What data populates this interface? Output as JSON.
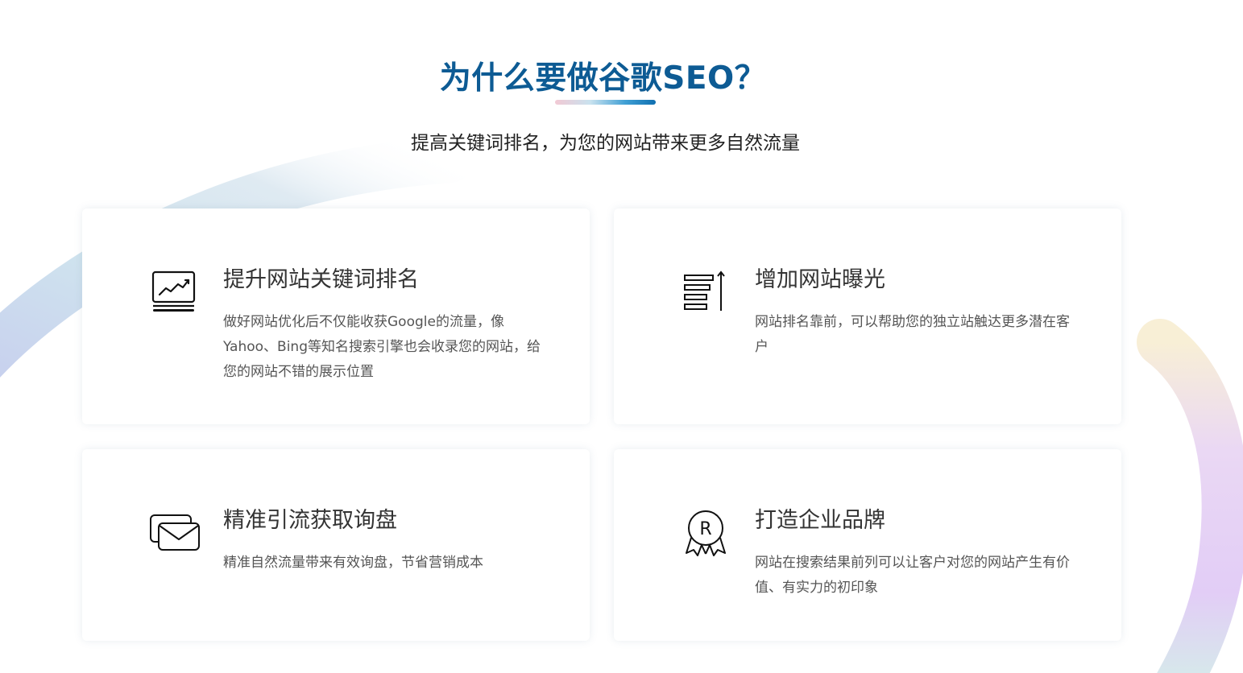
{
  "section": {
    "title": "为什么要做谷歌SEO？",
    "subtitle": "提高关键词排名，为您的网站带来更多自然流量"
  },
  "cards": [
    {
      "icon": "laptop-chart-icon",
      "heading": "提升网站关键词排名",
      "description": "做好网站优化后不仅能收获Google的流量，像Yahoo、Bing等知名搜索引擎也会收录您的网站，给您的网站不错的展示位置"
    },
    {
      "icon": "ranking-list-icon",
      "heading": "增加网站曝光",
      "description": "网站排名靠前，可以帮助您的独立站触达更多潜在客户"
    },
    {
      "icon": "envelope-inquiry-icon",
      "heading": "精准引流获取询盘",
      "description": "精准自然流量带来有效询盘，节省营销成本"
    },
    {
      "icon": "registered-badge-icon",
      "heading": "打造企业品牌",
      "description": "网站在搜索结果前列可以让客户对您的网站产生有价值、有实力的初印象"
    }
  ],
  "colors": {
    "title": "#0d5b94",
    "heading": "#333333",
    "text": "#555555"
  }
}
